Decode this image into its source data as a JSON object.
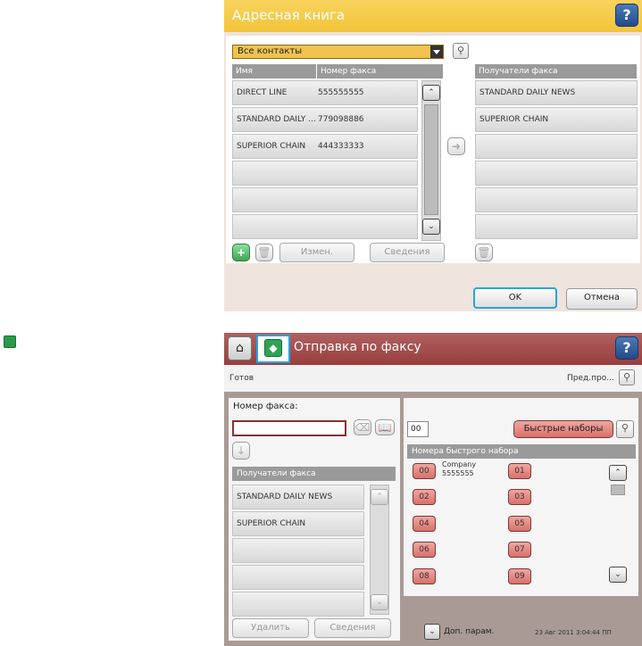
{
  "screen1": {
    "title": "Адресная книга",
    "help": "?",
    "dropdown": "Все контакты",
    "search_icon": "magnifier-icon",
    "col_name": "Имя",
    "col_fax": "Номер факса",
    "col_recipients": "Получатели факса",
    "contacts": [
      {
        "name": "DIRECT LINE",
        "fax": "555555555"
      },
      {
        "name": "STANDARD DAILY ...",
        "fax": "779098886"
      },
      {
        "name": "SUPERIOR CHAIN",
        "fax": "444333333"
      },
      {
        "name": "",
        "fax": ""
      },
      {
        "name": "",
        "fax": ""
      },
      {
        "name": "",
        "fax": ""
      }
    ],
    "recipients": [
      "STANDARD DAILY NEWS",
      "SUPERIOR CHAIN",
      "",
      "",
      "",
      ""
    ],
    "edit": "Измен.",
    "details": "Сведения",
    "ok": "OK",
    "cancel": "Отмена"
  },
  "screen2": {
    "title": "Отправка по факсу",
    "help": "?",
    "status": "Готов",
    "preview": "Пред.про...",
    "fax_number_label": "Номер факса:",
    "fax_number_value": "",
    "speed_input": "00",
    "speed_dials_btn": "Быстрые наборы",
    "speed_header": "Номера быстрого набора",
    "company_name": "Company",
    "company_number": "5555555",
    "speed_codes": [
      "00",
      "01",
      "02",
      "03",
      "04",
      "05",
      "06",
      "07",
      "08",
      "09"
    ],
    "recipients_header": "Получатели факса",
    "recipients": [
      "STANDARD DAILY NEWS",
      "SUPERIOR CHAIN",
      "",
      "",
      ""
    ],
    "delete": "Удалить",
    "details": "Сведения",
    "more_options": "Доп. парам.",
    "datetime": "23 Авг 2011 3:04:44 ПП"
  },
  "colors": {
    "yellow_header": "#f2c43a",
    "red_header": "#983e3e",
    "speed_key": "#d8706a",
    "focus": "#2aa3d8"
  }
}
